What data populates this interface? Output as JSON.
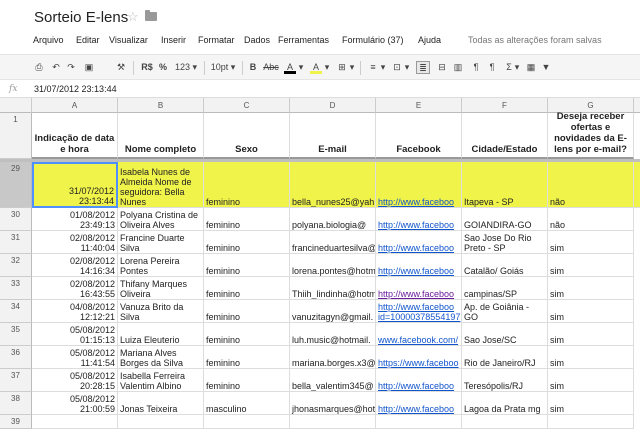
{
  "document": {
    "title": "Sorteio E-lens"
  },
  "menu": {
    "items": [
      "Arquivo",
      "Editar",
      "Visualizar",
      "Inserir",
      "Formatar",
      "Dados",
      "Ferramentas",
      "Formulário (37)",
      "Ajuda"
    ],
    "save_status": "Todas as alterações foram salvas"
  },
  "toolbar": {
    "currency": "R$",
    "percent": "%",
    "number_format": "123 ▾",
    "font_size": "10pt ▾",
    "bold": "B",
    "abc": "Abc",
    "text_color": "A",
    "fill_color": "A"
  },
  "formula_bar": {
    "fx": "fx",
    "value": "31/07/2012 23:13:44"
  },
  "columns": [
    "A",
    "B",
    "C",
    "D",
    "E",
    "F",
    "G"
  ],
  "header_row": {
    "row_number": "1",
    "cells": [
      "Indicação de data e hora",
      "Nome completo",
      "Sexo",
      "E-mail",
      "Facebook",
      "Cidade/Estado",
      "Deseja receber ofertas e novidades da E-lens por e-mail?"
    ]
  },
  "rows": [
    {
      "num": "29",
      "a": "31/07/2012\n23:13:44",
      "b": "Isabela Nunes de Almeida Nome de seguidora: Bella Nunes",
      "c": "feminino",
      "d": "bella_nunes25@yah",
      "e": "http://www.faceboo",
      "f": "Itapeva - SP",
      "g": "não"
    },
    {
      "num": "30",
      "a": "01/08/2012\n23:49:13",
      "b": "Polyana Cristina de Oliveira Alves",
      "c": "feminino",
      "d": "polyana.biologia@",
      "e": "http://www.faceboo",
      "f": "GOIANDIRA-GO",
      "g": "não"
    },
    {
      "num": "31",
      "a": "02/08/2012\n11:40:04",
      "b": "Francine Duarte Silva",
      "c": "feminino",
      "d": "francineduartesilva@",
      "e": "http://www.faceboo",
      "f": "Sao Jose Do Rio Preto - SP",
      "g": "sim"
    },
    {
      "num": "32",
      "a": "02/08/2012\n14:16:34",
      "b": "Lorena Pereira Pontes",
      "c": "feminino",
      "d": "lorena.pontes@hotm",
      "e": "http://www.faceboo",
      "f": "Catalão/ Goiás",
      "g": "sim"
    },
    {
      "num": "33",
      "a": "02/08/2012\n16:43:55",
      "b": "Thifany Marques Oliveira",
      "c": "feminino",
      "d": "Thiih_lindinha@hotm",
      "e": "http://www.faceboo",
      "f": "campinas/SP",
      "g": "sim"
    },
    {
      "num": "34",
      "a": "04/08/2012\n12:12:21",
      "b": "Vanuza Brito da Silva",
      "c": "feminino",
      "d": "vanuzitagyn@gmail.",
      "e": "http://www.faceboo\nid=10000378554197",
      "f": "Ap. de Goiânia - GO",
      "g": "sim"
    },
    {
      "num": "35",
      "a": "05/08/2012\n01:15:13",
      "b": "Luiza Eleuterio",
      "c": "feminino",
      "d": "luh.music@hotmail.",
      "e": "www.facebook.com/",
      "f": "Sao Jose/SC",
      "g": "sim"
    },
    {
      "num": "36",
      "a": "05/08/2012\n11:41:54",
      "b": "Mariana Alves Borges da Silva",
      "c": "feminino",
      "d": "mariana.borges.x3@",
      "e": "https://www.faceboo",
      "f": "Rio de Janeiro/RJ",
      "g": "sim"
    },
    {
      "num": "37",
      "a": "05/08/2012\n20:28:15",
      "b": "Isabella Ferreira Valentim Albino",
      "c": "feminino",
      "d": "bella_valentim345@",
      "e": "http://www.faceboo",
      "f": "Teresópolis/RJ",
      "g": "sim"
    },
    {
      "num": "38",
      "a": "05/08/2012\n21:00:59",
      "b": "Jonas Teixeira",
      "c": "masculino",
      "d": "jhonasmarques@hot",
      "e": "http://www.faceboo",
      "f": "Lagoa da Prata mg",
      "g": "sim"
    },
    {
      "num": "39",
      "a": "",
      "b": "",
      "c": "",
      "d": "",
      "e": "",
      "f": "",
      "g": ""
    }
  ],
  "colors": {
    "selected_row": "#f0f34a",
    "link": "#1155cc"
  }
}
